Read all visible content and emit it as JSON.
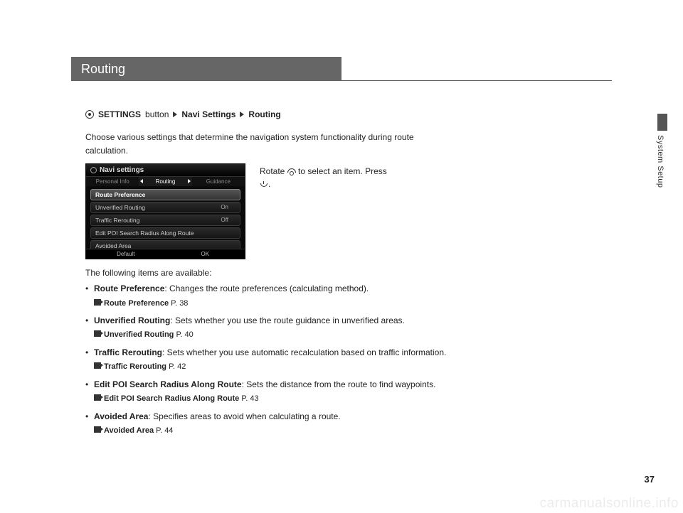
{
  "section_title": "Routing",
  "side_section": "System Setup",
  "page_number": "37",
  "watermark": "carmanualsonline.info",
  "breadcrumb": {
    "btn": "SETTINGS",
    "btn_suffix": "button",
    "step2": "Navi Settings",
    "step3": "Routing"
  },
  "intro": "Choose various settings that determine the navigation system functionality during route calculation.",
  "side_instruction": {
    "part1": "Rotate",
    "part2": "to select an item. Press",
    "part3": "."
  },
  "screenshot": {
    "header": "Navi settings",
    "tabs": [
      "Personal Info",
      "Routing",
      "Guidance"
    ],
    "items": [
      {
        "label": "Route Preference",
        "value": ""
      },
      {
        "label": "Unverified Routing",
        "value": "On"
      },
      {
        "label": "Traffic Rerouting",
        "value": "Off"
      },
      {
        "label": "Edit POI Search Radius Along Route",
        "value": ""
      },
      {
        "label": "Avoided Area",
        "value": ""
      }
    ],
    "footer": [
      "Default",
      "OK"
    ]
  },
  "available_heading": "The following items are available:",
  "items": [
    {
      "title": "Route Preference",
      "desc": ": Changes the route preferences (calculating method).",
      "xref_label": "Route Preference",
      "xref_page": "P. 38"
    },
    {
      "title": "Unverified Routing",
      "desc": ": Sets whether you use the route guidance in unverified areas.",
      "xref_label": "Unverified Routing",
      "xref_page": "P. 40"
    },
    {
      "title": "Traffic Rerouting",
      "desc": ": Sets whether you use automatic recalculation based on traffic information.",
      "xref_label": "Traffic Rerouting",
      "xref_page": "P. 42"
    },
    {
      "title": "Edit POI Search Radius Along Route",
      "desc": ": Sets the distance from the route to find waypoints.",
      "xref_label": "Edit POI Search Radius Along Route",
      "xref_page": "P. 43"
    },
    {
      "title": "Avoided Area",
      "desc": ": Specifies areas to avoid when calculating a route.",
      "xref_label": "Avoided Area",
      "xref_page": "P. 44"
    }
  ]
}
